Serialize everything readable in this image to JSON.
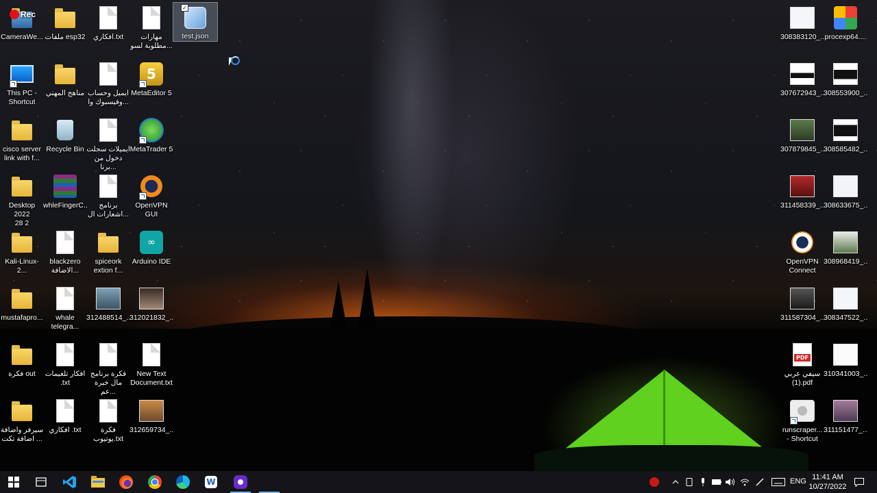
{
  "desktop": {
    "recording_badge": "Rec",
    "icons": [
      {
        "label": "CameraWe...",
        "icon": "camera-app-icon"
      },
      {
        "label": "ملفات esp32",
        "icon": "folder-icon"
      },
      {
        "label": "افكاري.txt",
        "icon": "text-file-icon"
      },
      {
        "label": "مهارات\nمطلوبة لسو...",
        "icon": "text-file-icon"
      },
      {
        "label": "test.json",
        "icon": "notepad-icon"
      },
      {
        "label": "This PC -\nShortcut",
        "icon": "this-pc-icon"
      },
      {
        "label": "مناهج المهني",
        "icon": "folder-icon"
      },
      {
        "label": "ايميل وحساب\nوفيسبوك وا...",
        "icon": "text-file-icon"
      },
      {
        "label": "MetaEditor 5",
        "icon": "metaeditor-icon"
      },
      {
        "label": "cisco server\nlink with f...",
        "icon": "folder-zip-icon"
      },
      {
        "label": "Recycle Bin",
        "icon": "recycle-bin-icon"
      },
      {
        "label": "ايميلات سجلت\nدخول من برنا...",
        "icon": "text-file-icon"
      },
      {
        "label": "MetaTrader 5",
        "icon": "metatrader-icon"
      },
      {
        "label": "Desktop 2022\n28 2",
        "icon": "folder-icon"
      },
      {
        "label": "whleFingerC...",
        "icon": "winrar-icon"
      },
      {
        "label": "برنامج\nاشعارات ال...",
        "icon": "text-file-icon"
      },
      {
        "label": "OpenVPN\nGUI",
        "icon": "openvpn-gui-icon"
      },
      {
        "label": "Kali-Linux-2...",
        "icon": "folder-icon"
      },
      {
        "label": "blackzero\nالاضافة...",
        "icon": "text-file-icon"
      },
      {
        "label": "spiceork\nextion f...",
        "icon": "folder-zip-icon"
      },
      {
        "label": "Arduino IDE",
        "icon": "arduino-icon"
      },
      {
        "label": "mustafapro...",
        "icon": "folder-icon"
      },
      {
        "label": "whale\ntelegra...",
        "icon": "text-file-icon"
      },
      {
        "label": "312488514_...",
        "icon": "image-thumbnail-icon"
      },
      {
        "label": "312021832_...",
        "icon": "image-thumbnail-icon"
      },
      {
        "label": "فكرة out",
        "icon": "folder-icon"
      },
      {
        "label": "افكار تلغيمات\n.txt",
        "icon": "text-file-icon"
      },
      {
        "label": "فكرة برنامج\nمال خبرة عم...",
        "icon": "text-file-icon"
      },
      {
        "label": "New Text\nDocument.txt",
        "icon": "text-file-icon"
      },
      {
        "label": "سيرفر واضافة\nاضافة تكت ...",
        "icon": "folder-icon"
      },
      {
        "label": "افكاري .txt",
        "icon": "text-file-icon"
      },
      {
        "label": "فكرة\nيوتيوب.txt",
        "icon": "text-file-icon"
      },
      {
        "label": "312659734_...",
        "icon": "image-thumbnail-icon"
      }
    ],
    "right_icons": [
      {
        "label": "308383120_...",
        "icon": "image-thumbnail-icon"
      },
      {
        "label": "procexp64....",
        "icon": "procexp-icon"
      },
      {
        "label": "307672943_...",
        "icon": "image-thumbnail-icon"
      },
      {
        "label": "308553900_...",
        "icon": "image-thumbnail-icon"
      },
      {
        "label": "307879845_...",
        "icon": "image-thumbnail-icon"
      },
      {
        "label": "308585482_...",
        "icon": "image-thumbnail-icon"
      },
      {
        "label": "311458339_...",
        "icon": "image-thumbnail-icon"
      },
      {
        "label": "308633675_...",
        "icon": "image-thumbnail-icon"
      },
      {
        "label": "OpenVPN\nConnect",
        "icon": "openvpn-connect-icon"
      },
      {
        "label": "308968419_...",
        "icon": "image-thumbnail-icon"
      },
      {
        "label": "311587304_...",
        "icon": "image-thumbnail-icon"
      },
      {
        "label": "308347522_...",
        "icon": "image-thumbnail-icon"
      },
      {
        "label": "سيفي عربي\n(1).pdf",
        "icon": "pdf-icon"
      },
      {
        "label": "310341003_...",
        "icon": "image-thumbnail-icon"
      },
      {
        "label": "runscraper...\n- Shortcut",
        "icon": "gear-shortcut-icon"
      },
      {
        "label": "311151477_...",
        "icon": "image-thumbnail-icon"
      }
    ]
  },
  "taskbar": {
    "pinned": [
      {
        "name": "windows-start-icon"
      },
      {
        "name": "task-view-icon"
      },
      {
        "name": "vscode-icon"
      },
      {
        "name": "file-explorer-icon"
      },
      {
        "name": "firefox-icon"
      },
      {
        "name": "chrome-icon"
      },
      {
        "name": "edge-icon"
      },
      {
        "name": "word-icon"
      },
      {
        "name": "recorder-app-icon"
      }
    ],
    "tray": {
      "language": "ENG",
      "time": "11:41 AM",
      "date": "10/27/2022"
    }
  }
}
